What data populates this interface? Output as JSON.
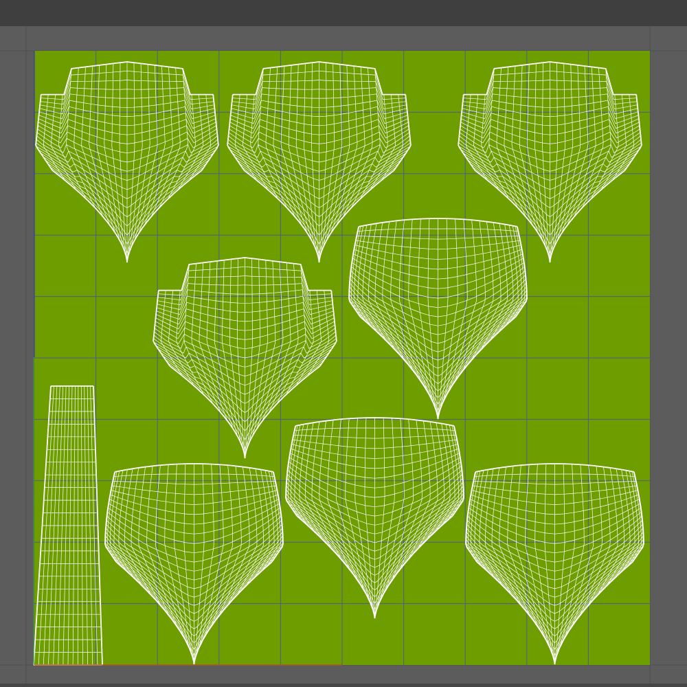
{
  "app": {
    "view": "uv-editor",
    "background_color": "#5c5c5c",
    "toolbar_color": "#3f3f3f"
  },
  "uv_space": {
    "tile_color": "#6e9d00",
    "grid_color": "#4d5c8a",
    "wire_color": "#ffffff",
    "u_axis_color": "#b5521e",
    "v_axis_color": "#2f3fa8",
    "grid_divisions": 10
  },
  "islands": [
    {
      "id": "petal-heart-1",
      "kind": "heart"
    },
    {
      "id": "petal-heart-2",
      "kind": "heart"
    },
    {
      "id": "petal-heart-3",
      "kind": "heart"
    },
    {
      "id": "petal-heart-4",
      "kind": "heart"
    },
    {
      "id": "petal-round-1",
      "kind": "round"
    },
    {
      "id": "petal-round-2",
      "kind": "round"
    },
    {
      "id": "petal-round-3",
      "kind": "round"
    },
    {
      "id": "petal-round-4",
      "kind": "round"
    },
    {
      "id": "stem-strip",
      "kind": "stem"
    }
  ]
}
